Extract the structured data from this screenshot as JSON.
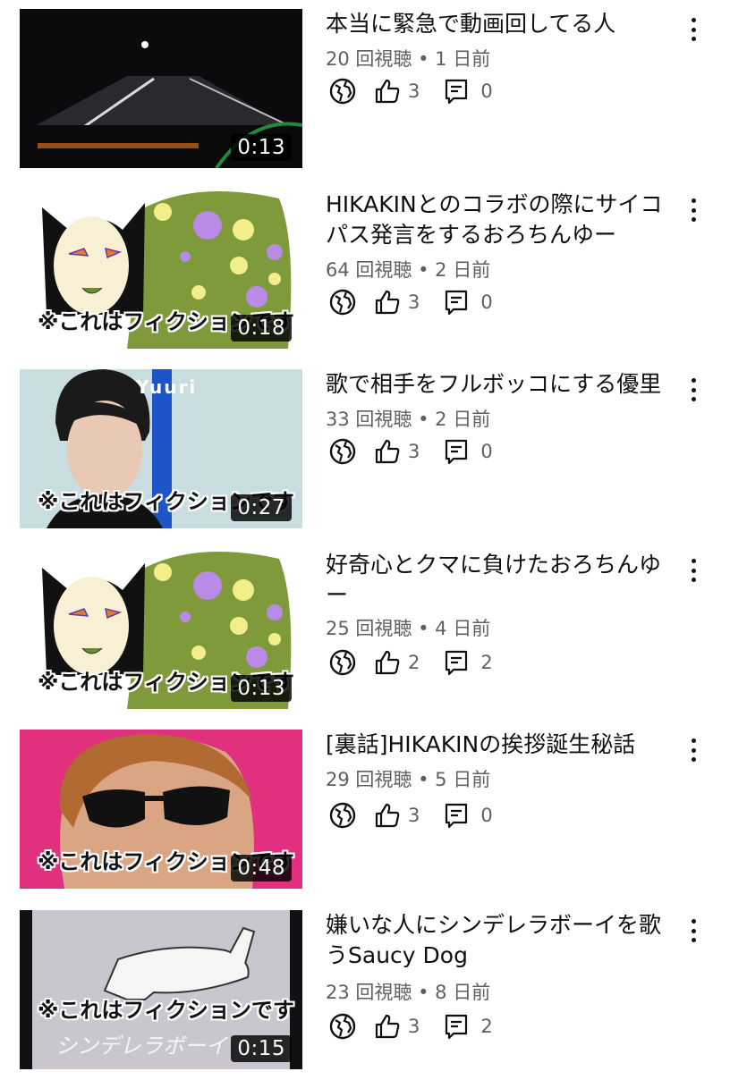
{
  "videos": [
    {
      "title": "本当に緊急で動画回してる人",
      "views": "20 回視聴",
      "age": "1 日前",
      "duration": "0:13",
      "likes": "3",
      "comments": "0"
    },
    {
      "title": "HIKAKINとのコラボの際にサイコパス発言をするおろちんゆー",
      "views": "64 回視聴",
      "age": "2 日前",
      "duration": "0:18",
      "likes": "3",
      "comments": "0",
      "caption": "※これはフィクションです"
    },
    {
      "title": "歌で相手をフルボッコにする優里",
      "views": "33 回視聴",
      "age": "2 日前",
      "duration": "0:27",
      "likes": "3",
      "comments": "0",
      "caption": "※これはフィクションです",
      "name_tag": "Yuuri"
    },
    {
      "title": "好奇心とクマに負けたおろちんゆー",
      "views": "25 回視聴",
      "age": "4 日前",
      "duration": "0:13",
      "likes": "2",
      "comments": "2",
      "caption": "※これはフィクションです"
    },
    {
      "title": "[裏話]HIKAKINの挨拶誕生秘話",
      "views": "29 回視聴",
      "age": "5 日前",
      "duration": "0:48",
      "likes": "3",
      "comments": "0",
      "caption": "※これはフィクションです"
    },
    {
      "title": "嫌いな人にシンデレラボーイを歌うSaucy Dog",
      "views": "23 回視聴",
      "age": "8 日前",
      "duration": "0:15",
      "likes": "3",
      "comments": "2",
      "caption": "※これはフィクションです",
      "thumb_text": "シンデレラボーイ"
    }
  ],
  "separator": " • ",
  "colors": {
    "meta": "#606060",
    "text": "#0f0f0f",
    "green": "#7f9a3a",
    "purple": "#b98ae6",
    "yellow": "#f2ee8a",
    "pink": "#e0307e",
    "sky": "#c9dde0"
  },
  "icons": {
    "visibility": "globe-icon",
    "like": "thumb-up-icon",
    "comment": "comment-icon",
    "more": "more-vert-icon"
  }
}
